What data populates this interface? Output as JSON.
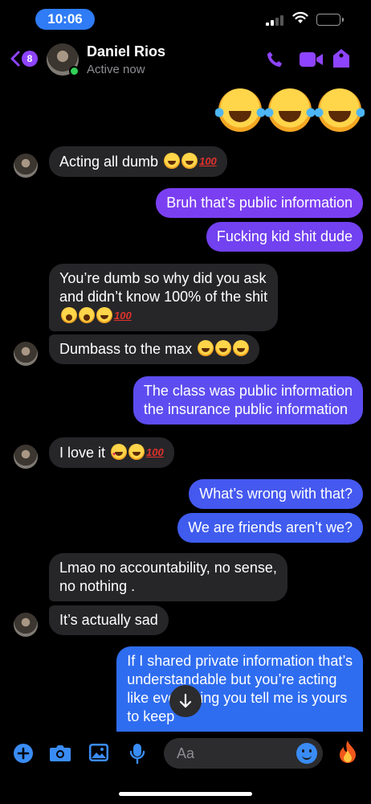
{
  "status_bar": {
    "time": "10:06"
  },
  "header": {
    "unread_count": "8",
    "contact_name": "Daniel Rios",
    "status": "Active now",
    "accent_color": "#8e44ff"
  },
  "messages": [
    {
      "side": "received",
      "text": "Acting all dumb",
      "emoji": [
        "joy",
        "joy",
        "100"
      ]
    },
    {
      "side": "sent",
      "text": "Bruh that’s public information"
    },
    {
      "side": "sent",
      "text": "Fucking kid shit dude"
    },
    {
      "side": "received",
      "text": "You’re dumb so why did you ask\nand didn’t know 100% of the shit",
      "emoji": [
        "yawn",
        "yawn",
        "joy",
        "100"
      ]
    },
    {
      "side": "received",
      "text": "Dumbass to the max",
      "emoji": [
        "joy",
        "joy",
        "joy"
      ]
    },
    {
      "side": "sent",
      "text": "The class was public information\nthe insurance public information"
    },
    {
      "side": "received",
      "text": "I love it",
      "emoji": [
        "heart-eyes",
        "joy",
        "100"
      ]
    },
    {
      "side": "sent",
      "text": "What’s wrong with that?"
    },
    {
      "side": "sent",
      "text": "We are friends aren’t we?"
    },
    {
      "side": "received",
      "text": "Lmao no accountability, no sense,\nno nothing ."
    },
    {
      "side": "received",
      "text": "It’s actually sad"
    },
    {
      "side": "sent",
      "text": "If I shared private information that’s\nunderstandable but you’re acting\nlike everything you tell me is yours\nto keep"
    }
  ],
  "composer": {
    "placeholder": "Aa",
    "icons": [
      "plus-icon",
      "camera-icon",
      "image-icon",
      "microphone-icon",
      "emoji-icon",
      "fire-icon"
    ]
  },
  "emoji_burst": [
    "joy",
    "joy",
    "joy"
  ]
}
